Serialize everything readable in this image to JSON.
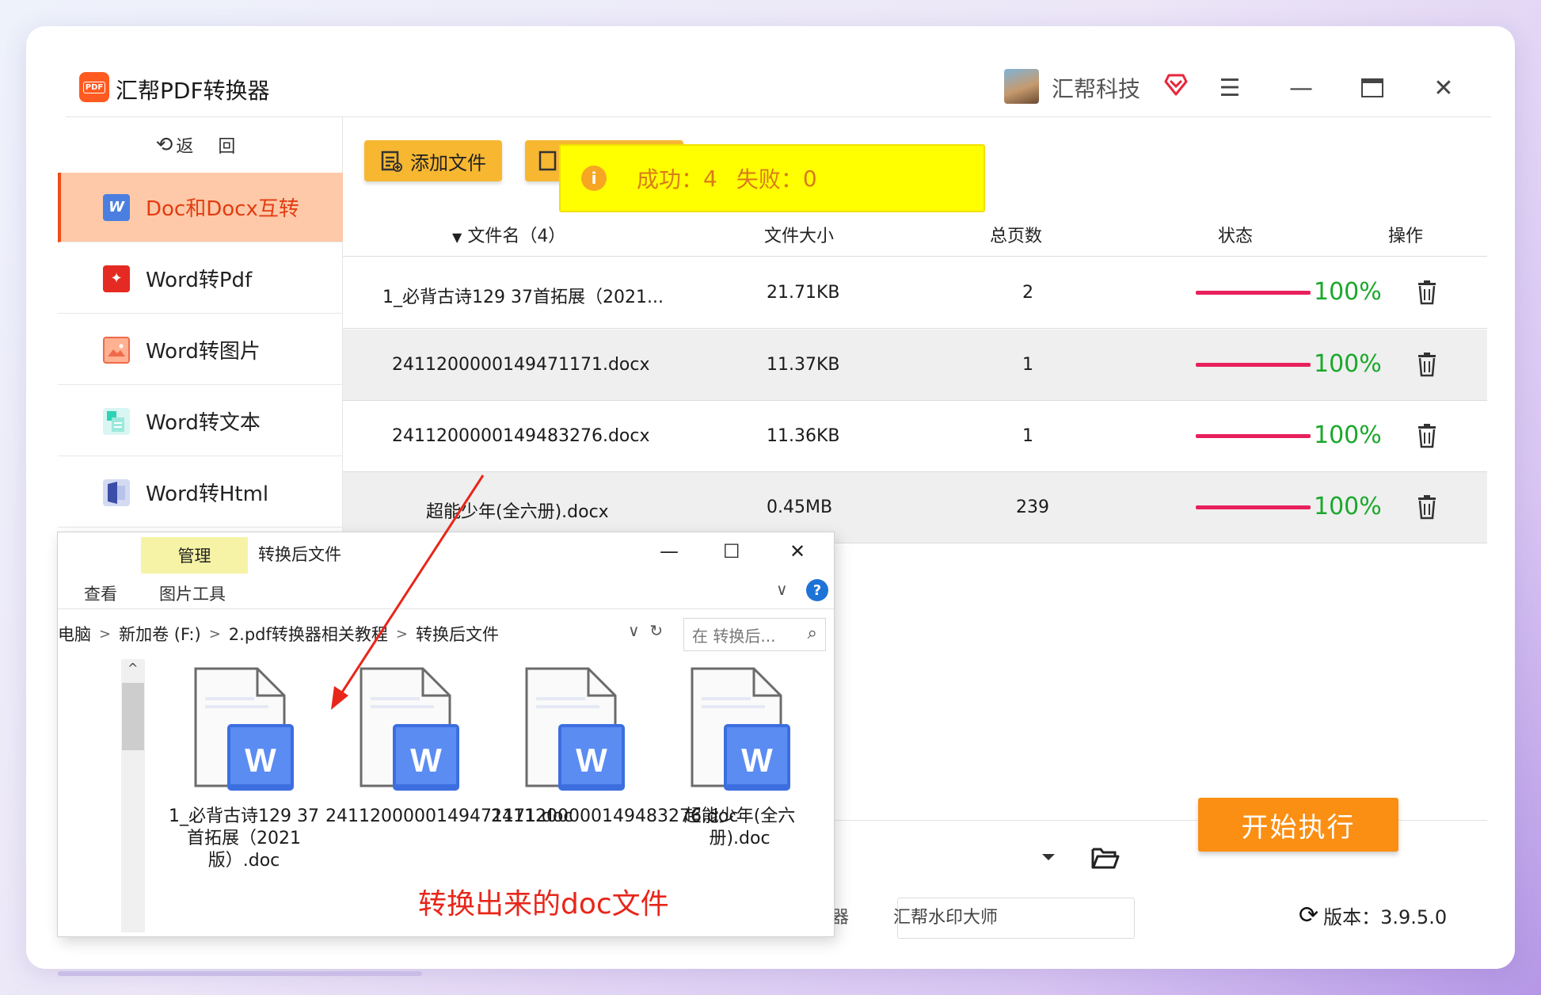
{
  "app": {
    "title": "汇帮PDF转换器",
    "logo_text": "PDF",
    "username": "汇帮科技"
  },
  "sidebar": {
    "back_label": "返 回",
    "items": [
      {
        "label": "Doc和Docx互转",
        "icon": "word-doc-icon",
        "active": true
      },
      {
        "label": "Word转Pdf",
        "icon": "pdf-icon"
      },
      {
        "label": "Word转图片",
        "icon": "image-icon"
      },
      {
        "label": "Word转文本",
        "icon": "text-doc-icon"
      },
      {
        "label": "Word转Html",
        "icon": "html-icon"
      }
    ]
  },
  "toolbar": {
    "add_file_label": "添加文件"
  },
  "toast": {
    "success_label": "成功：",
    "success_count": "4",
    "fail_label": "失败：",
    "fail_count": "0"
  },
  "table": {
    "headers": {
      "name": "文件名（4）",
      "size": "文件大小",
      "pages": "总页数",
      "status": "状态",
      "action": "操作"
    },
    "rows": [
      {
        "name": "1_必背古诗129 37首拓展（2021...",
        "size": "21.71KB",
        "pages": "2",
        "progress": "100%"
      },
      {
        "name": "2411200000149471171.docx",
        "size": "11.37KB",
        "pages": "1",
        "progress": "100%"
      },
      {
        "name": "2411200000149483276.docx",
        "size": "11.36KB",
        "pages": "1",
        "progress": "100%"
      },
      {
        "name": "超能少年(全六册).docx",
        "size": "0.45MB",
        "pages": "239",
        "progress": "100%"
      }
    ]
  },
  "actions": {
    "start_label": "开始执行"
  },
  "footer": {
    "link_partial": "器",
    "link_watermark": "汇帮水印大师",
    "version_label": "版本：3.9.5.0"
  },
  "explorer": {
    "manage_tab": "管理",
    "window_title": "转换后文件",
    "tab_view": "查看",
    "tab_picture_tools": "图片工具",
    "breadcrumb": [
      "电脑",
      "新加卷 (F:)",
      "2.pdf转换器相关教程",
      "转换后文件"
    ],
    "search_placeholder": "在 转换后...",
    "files": [
      {
        "label": "1_必背古诗129 37首拓展（2021版）.doc"
      },
      {
        "label": "2411200000149471171.doc"
      },
      {
        "label": "2411200000149483276.doc"
      },
      {
        "label": "超能少年(全六册).doc"
      }
    ]
  },
  "annotation": {
    "text": "转换出来的doc文件",
    "color": "#e8261a"
  },
  "colors": {
    "accent_orange": "#fb8f13",
    "active_nav_bg": "#fdc9a8",
    "progress_bar": "#e8205c",
    "progress_text": "#1aa82b",
    "toast_bg": "#ffff00"
  }
}
